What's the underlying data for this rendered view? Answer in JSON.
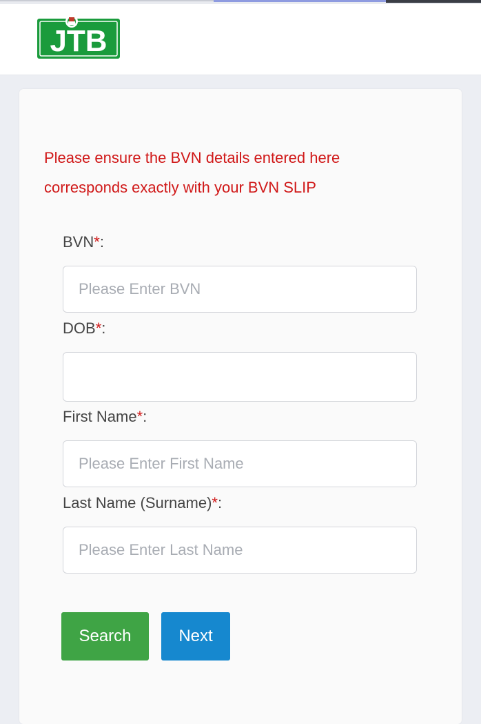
{
  "header": {
    "logo_text": "JTB"
  },
  "notice": {
    "line1": "Please ensure the BVN details entered here",
    "line2": "corresponds exactly with your BVN SLIP"
  },
  "form": {
    "required_mark": "*",
    "bvn": {
      "label": "BVN",
      "placeholder": "Please Enter BVN",
      "value": ""
    },
    "dob": {
      "label": "DOB",
      "placeholder": "",
      "value": ""
    },
    "first_name": {
      "label": "First Name",
      "placeholder": "Please Enter First Name",
      "value": ""
    },
    "last_name": {
      "label": "Last Name (Surname)",
      "placeholder": "Please Enter Last Name",
      "value": ""
    }
  },
  "buttons": {
    "search": "Search",
    "next": "Next"
  },
  "colors": {
    "brand_green": "#1a9b3c",
    "warning_red": "#d01818",
    "search_green": "#3fa445",
    "next_blue": "#1688cf"
  }
}
